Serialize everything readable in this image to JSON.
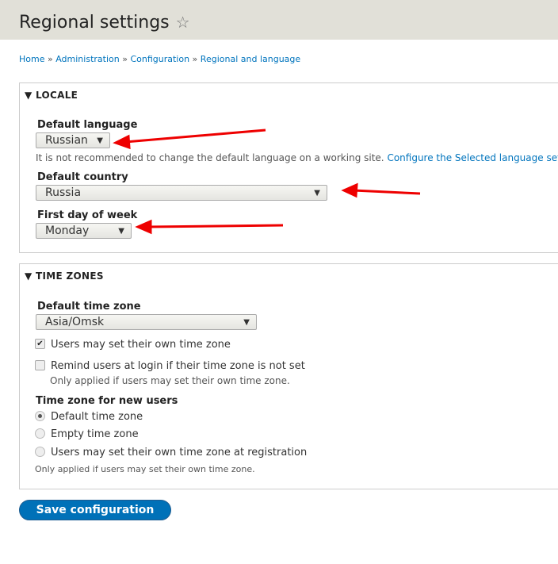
{
  "header": {
    "title": "Regional settings",
    "star_icon": "star-outline-icon"
  },
  "breadcrumb": [
    "Home",
    "Administration",
    "Configuration",
    "Regional and language"
  ],
  "locale": {
    "legend": "LOCALE",
    "default_language": {
      "label": "Default language",
      "value": "Russian"
    },
    "language_desc": "It is not recommended to change the default language on a working site.",
    "language_link": "Configure the Selected language setti",
    "default_country": {
      "label": "Default country",
      "value": "Russia"
    },
    "first_day": {
      "label": "First day of week",
      "value": "Monday"
    }
  },
  "timezones": {
    "legend": "TIME ZONES",
    "default_tz": {
      "label": "Default time zone",
      "value": "Asia/Omsk"
    },
    "users_may_set": {
      "label": "Users may set their own time zone",
      "checked": true
    },
    "remind": {
      "label": "Remind users at login if their time zone is not set",
      "checked": false,
      "desc": "Only applied if users may set their own time zone."
    },
    "new_users": {
      "label": "Time zone for new users",
      "options": [
        "Default time zone",
        "Empty time zone",
        "Users may set their own time zone at registration"
      ],
      "selected": 0,
      "desc": "Only applied if users may set their own time zone."
    }
  },
  "save_label": "Save configuration",
  "annotation_color": "#ee0000"
}
